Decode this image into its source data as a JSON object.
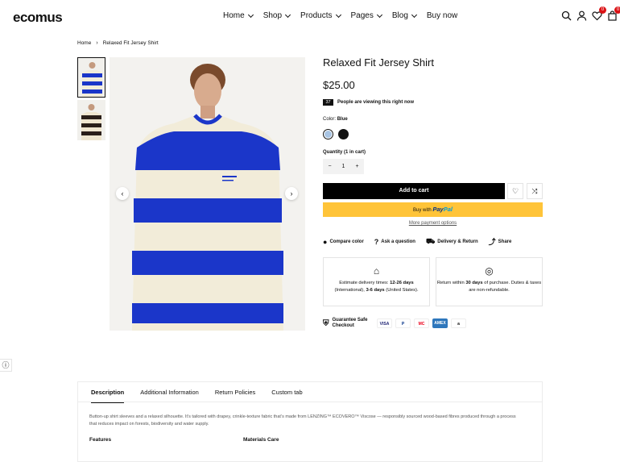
{
  "header": {
    "logo": "ecomus",
    "nav": [
      {
        "label": "Home",
        "has_dropdown": true
      },
      {
        "label": "Shop",
        "has_dropdown": true
      },
      {
        "label": "Products",
        "has_dropdown": true
      },
      {
        "label": "Pages",
        "has_dropdown": true
      },
      {
        "label": "Blog",
        "has_dropdown": true
      },
      {
        "label": "Buy now",
        "has_dropdown": false
      }
    ],
    "wishlist_count": "0",
    "cart_count": "0"
  },
  "breadcrumb": {
    "home": "Home",
    "current": "Relaxed Fit Jersey Shirt"
  },
  "product": {
    "title": "Relaxed Fit Jersey Shirt",
    "price": "$25.00",
    "viewers_count": "37",
    "viewers_text": "People are viewing this right now",
    "color_label": "Color:",
    "color_value": "Blue",
    "colors": [
      "#a8c4e3",
      "#111111"
    ],
    "quantity_label": "Quantity (1 in cart)",
    "quantity": "1",
    "minus": "−",
    "plus": "+",
    "add_to_cart": "Add to cart",
    "buy_with": "Buy with",
    "paypal_a": "Pay",
    "paypal_b": "Pal",
    "more_payment": "More payment options"
  },
  "actions": {
    "compare": "Compare color",
    "ask": "Ask a question",
    "delivery": "Delivery & Return",
    "share": "Share"
  },
  "info": {
    "delivery_pre": "Estimate delivery times:",
    "delivery_days1": "12-26 days",
    "delivery_mid": "(International),",
    "delivery_days2": "3-6 days",
    "delivery_post": "(United States).",
    "return_pre": "Return within",
    "return_days": "30 days",
    "return_post": "of purchase. Duties & taxes are non-refundable."
  },
  "guarantee": {
    "line1": "Guarantee Safe",
    "line2": "Checkout"
  },
  "payment_cards": [
    "VISA",
    "P",
    "MC",
    "AMEX",
    "a"
  ],
  "tabs": {
    "items": [
      "Description",
      "Additional Information",
      "Return Policies",
      "Custom tab"
    ],
    "active": "Description",
    "description": "Button-up shirt sleeves and a relaxed silhouette. It’s tailored with drapey, crinkle-texture fabric that’s made from LENZING™ ECOVERO™ Viscose — responsibly sourced wood-based fibres produced through a process that reduces impact on forests, biodiversity and water supply.",
    "features_title": "Features",
    "materials_title": "Materials Care"
  }
}
